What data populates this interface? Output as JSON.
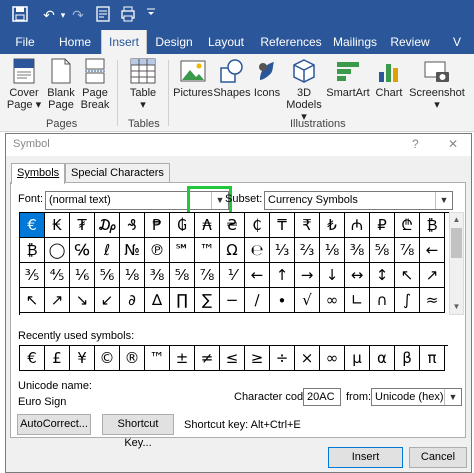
{
  "title_bar": {
    "icons": [
      "save-icon",
      "undo-icon",
      "redo-icon",
      "touch-mode-icon",
      "customize-qat-icon"
    ],
    "undo": "↶",
    "redo": "↷",
    "dropdown": "▾",
    "bg_color": "#2b579a"
  },
  "menu": {
    "tabs": [
      "File",
      "Home",
      "Insert",
      "Design",
      "Layout",
      "References",
      "Mailings",
      "Review",
      "V"
    ],
    "active": "Insert"
  },
  "ribbon": {
    "buttons": {
      "cover_page": [
        "Cover",
        "Page ▾"
      ],
      "blank_page": [
        "Blank",
        "Page"
      ],
      "page_break": [
        "Page",
        "Break"
      ],
      "table": [
        "Table",
        "▾"
      ],
      "pictures": "Pictures",
      "shapes": "Shapes",
      "icons": "Icons",
      "models": [
        "3D",
        "Models ▾"
      ],
      "smartart": "SmartArt",
      "chart": "Chart",
      "screenshot": [
        "Screenshot",
        "▾"
      ]
    },
    "groups": {
      "pages": "Pages",
      "tables": "Tables",
      "illustrations": "Illustrations"
    }
  },
  "dialog": {
    "title": "Symbol",
    "help": "?",
    "close": "✕",
    "tabs": {
      "symbols": "Symbols",
      "special": "Special Characters"
    },
    "font": {
      "label": "Font:",
      "value": "(normal text)"
    },
    "subset": {
      "label": "Subset:",
      "value": "Currency Symbols"
    },
    "highlight_color": "#22c83a",
    "selection_color": "#0078d7",
    "grid": [
      [
        "€",
        "₭",
        "₮",
        "₯",
        "₰",
        "₱",
        "₲",
        "₳",
        "₴",
        "₵",
        "₸",
        "₹",
        "₺",
        "₼",
        "₽",
        "₾",
        "₿"
      ],
      [
        "₿",
        "◯",
        "℅",
        "ℓ",
        "№",
        "℗",
        "℠",
        "™",
        "Ω",
        "℮",
        "⅓",
        "⅔",
        "⅛",
        "⅜",
        "⅝",
        "⅞",
        "←"
      ],
      [
        "⅗",
        "⅘",
        "⅙",
        "⅚",
        "⅛",
        "⅜",
        "⅝",
        "⅞",
        "⅟",
        "←",
        "↑",
        "→",
        "↓",
        "↔",
        "↕",
        "↖",
        "↗"
      ],
      [
        "↖",
        "↗",
        "↘",
        "↙",
        "∂",
        "∆",
        "∏",
        "∑",
        "−",
        "∕",
        "∙",
        "√",
        "∞",
        "∟",
        "∩",
        "∫",
        "≈"
      ]
    ],
    "recent_label": "Recently used symbols:",
    "recent": [
      "€",
      "£",
      "¥",
      "©",
      "®",
      "™",
      "±",
      "≠",
      "≤",
      "≥",
      "÷",
      "×",
      "∞",
      "µ",
      "α",
      "β",
      "π"
    ],
    "unicode_name_label": "Unicode name:",
    "unicode_name": "Euro Sign",
    "char_code_label": "Character code:",
    "char_code": "20AC",
    "from_label": "from:",
    "from_value": "Unicode (hex)",
    "autocorrect": "AutoCorrect...",
    "shortcut_key": "Shortcut Key...",
    "shortcut_label": "Shortcut key: Alt+Ctrl+E",
    "insert": "Insert",
    "cancel": "Cancel"
  }
}
